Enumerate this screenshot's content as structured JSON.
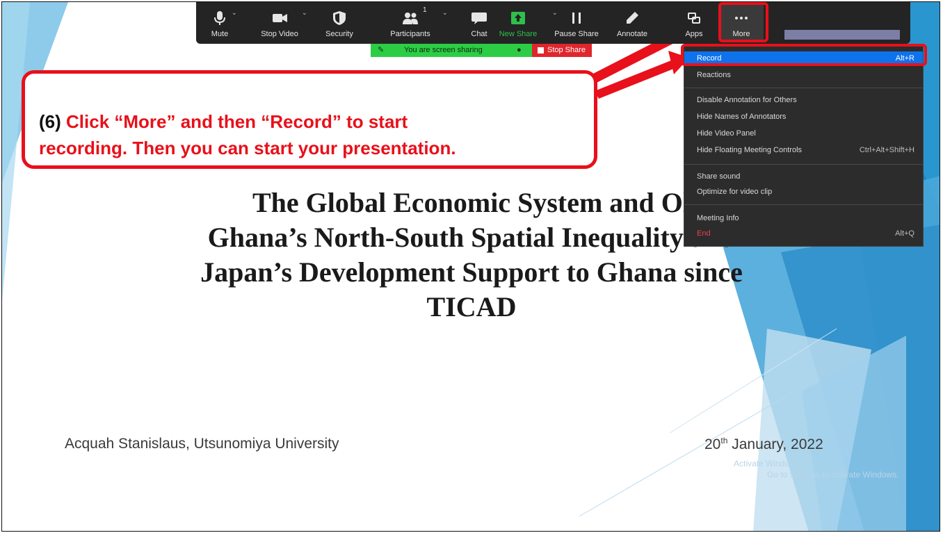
{
  "toolbar": {
    "mute": "Mute",
    "stop_video": "Stop Video",
    "security": "Security",
    "participants": "Participants",
    "participant_count": "1",
    "chat": "Chat",
    "new_share": "New Share",
    "pause_share": "Pause Share",
    "annotate": "Annotate",
    "apps": "Apps",
    "more": "More"
  },
  "sharing": {
    "status": "You are screen sharing",
    "stop": "Stop Share"
  },
  "menu": {
    "items": [
      {
        "label": "Record",
        "shortcut": "Alt+R"
      },
      {
        "label": "Reactions",
        "shortcut": ""
      },
      {
        "label": "Disable Annotation for Others",
        "shortcut": ""
      },
      {
        "label": "Hide Names of Annotators",
        "shortcut": ""
      },
      {
        "label": "Hide Video Panel",
        "shortcut": ""
      },
      {
        "label": "Hide Floating Meeting Controls",
        "shortcut": "Ctrl+Alt+Shift+H"
      },
      {
        "label": "Share sound",
        "shortcut": ""
      },
      {
        "label": "Optimize for video clip",
        "shortcut": ""
      },
      {
        "label": "Meeting Info",
        "shortcut": ""
      },
      {
        "label": "End",
        "shortcut": "Alt+Q"
      }
    ]
  },
  "callout": {
    "number": "(6)",
    "line1": "Click “More” and then “Record” to start",
    "line2": "recording. Then you can start your presentation."
  },
  "slide": {
    "title_lines": [
      "The Global Economic System and Ol",
      "Ghana’s North-South Spatial Inequality and",
      "Japan’s Development Support to Ghana since",
      "TICAD"
    ],
    "author": "Acquah Stanislaus, Utsunomiya University",
    "date_day": "20",
    "date_suffix": "th",
    "date_rest": " January, 2022",
    "watermark_line1": "Activate Windows",
    "watermark_line2": "Go to Settings to activate Windows."
  },
  "colors": {
    "accent_red": "#e8101a",
    "toolbar_bg": "#242424",
    "menu_highlight": "#0e72ed",
    "share_green": "#2ccd45"
  }
}
